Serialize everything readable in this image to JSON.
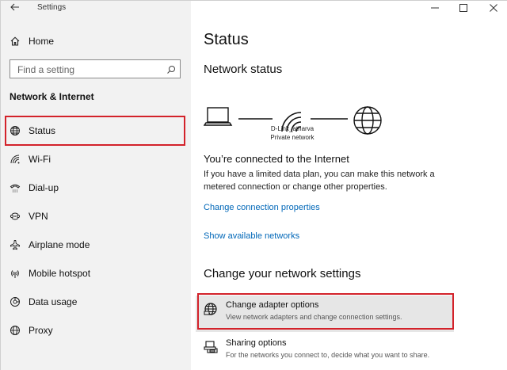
{
  "app": {
    "title": "Settings"
  },
  "sidebar": {
    "home_label": "Home",
    "search": {
      "placeholder": "Find a setting"
    },
    "section_header": "Network & Internet",
    "items": [
      {
        "label": "Status",
        "icon": "globe-icon",
        "selected": true
      },
      {
        "label": "Wi-Fi",
        "icon": "wifi-icon"
      },
      {
        "label": "Dial-up",
        "icon": "dialup-icon"
      },
      {
        "label": "VPN",
        "icon": "vpn-icon"
      },
      {
        "label": "Airplane mode",
        "icon": "airplane-icon"
      },
      {
        "label": "Mobile hotspot",
        "icon": "hotspot-icon"
      },
      {
        "label": "Data usage",
        "icon": "data-usage-icon"
      },
      {
        "label": "Proxy",
        "icon": "globe-icon"
      }
    ]
  },
  "main": {
    "page_title": "Status",
    "network_status_title": "Network status",
    "network": {
      "name": "D-Link_atharva",
      "type": "Private network"
    },
    "connected_heading": "You’re connected to the Internet",
    "connected_desc": "If you have a limited data plan, you can make this network a metered connection or change other properties.",
    "link_change_properties": "Change connection properties",
    "link_show_networks": "Show available networks",
    "change_settings_title": "Change your network settings",
    "settings": [
      {
        "title": "Change adapter options",
        "desc": "View network adapters and change connection settings.",
        "icon": "adapter-globe-icon"
      },
      {
        "title": "Sharing options",
        "desc": "For the networks you connect to, decide what you want to share.",
        "icon": "sharing-icon"
      }
    ]
  },
  "colors": {
    "accent_link": "#0067b8",
    "highlight_border": "#d3222a",
    "sidebar_bg": "#f2f2f2"
  }
}
